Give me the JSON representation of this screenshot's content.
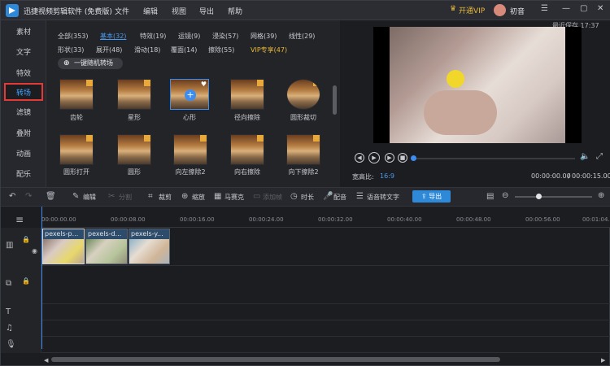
{
  "titlebar": {
    "app_title": "迅捷视频剪辑软件 (免费版)",
    "menu": [
      "文件",
      "编辑",
      "视图",
      "导出",
      "帮助"
    ],
    "vip_label": "开通VIP",
    "user_name": "初音"
  },
  "sidebar": {
    "items": [
      "素材",
      "文字",
      "特效",
      "转场",
      "滤镜",
      "叠附",
      "动画",
      "配乐"
    ],
    "active_index": 3
  },
  "library": {
    "categories": [
      "全部(353)",
      "基本(32)",
      "特效(19)",
      "运镜(9)",
      "浸染(57)",
      "网格(39)",
      "线性(29)",
      "形状(33)",
      "展开(48)",
      "滑动(18)",
      "覆面(14)",
      "擦除(55)",
      "VIP专享(47)"
    ],
    "random_button": "一键随机转场",
    "tiles_row1": [
      "齿轮",
      "星形",
      "心形",
      "径向擦除",
      "圆形裁切"
    ],
    "tiles_row2": [
      "圆形打开",
      "圆形",
      "向左擦除2",
      "向右擦除",
      "向下擦除2"
    ]
  },
  "preview": {
    "autosave": "最近保存 17:37",
    "aspect_label": "宽高比:",
    "aspect_value": "16:9",
    "time_current": "00:00:00.00",
    "time_total": "00:00:15.00"
  },
  "toolbar": {
    "items": [
      "编辑",
      "分割",
      "裁剪",
      "缩放",
      "马赛克",
      "添加帧",
      "时长",
      "配音",
      "语音转文字"
    ],
    "export_label": "导出"
  },
  "timeline": {
    "ticks": [
      "00:00:00.00",
      "00:00:08.00",
      "00:00:16.00",
      "00:00:24.00",
      "00:00:32.00",
      "00:00:40.00",
      "00:00:48.00",
      "00:00:56.00",
      "00:01:04.00"
    ],
    "clips": [
      {
        "label": "pexels-p..."
      },
      {
        "label": "pexels-d..."
      },
      {
        "label": "pexels-y..."
      }
    ]
  },
  "colors": {
    "accent": "#2e8ad8",
    "vip": "#e9b93a",
    "active_border": "#e53935"
  }
}
